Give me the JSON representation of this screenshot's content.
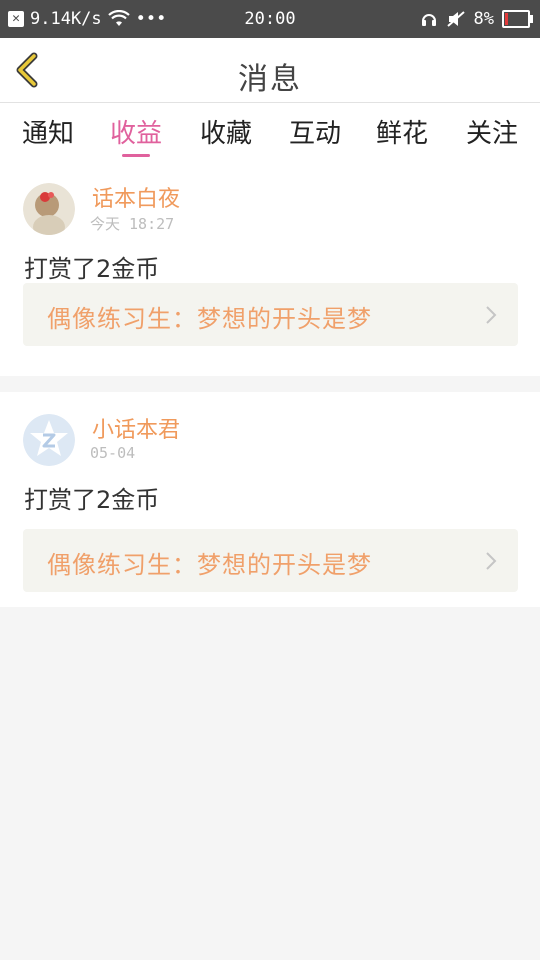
{
  "status_bar": {
    "net_speed": "9.14K/s",
    "dots": "•••",
    "time": "20:00",
    "battery": "8%"
  },
  "header": {
    "title": "消息"
  },
  "tabs": [
    {
      "label": "通知"
    },
    {
      "label": "收益"
    },
    {
      "label": "收藏"
    },
    {
      "label": "互动"
    },
    {
      "label": "鲜花"
    },
    {
      "label": "关注"
    }
  ],
  "active_tab": "收益",
  "messages": [
    {
      "user": "话本白夜",
      "time": "今天 18:27",
      "text": "打赏了2金币",
      "link": "偶像练习生：梦想的开头是梦"
    },
    {
      "user": "小话本君",
      "time": "05-04",
      "text": "打赏了2金币",
      "link": "偶像练习生：梦想的开头是梦"
    }
  ],
  "colors": {
    "accent": "#e0619d",
    "username": "#f09a5c",
    "link": "#f0a06a",
    "back_arrow": "#e8c93a"
  }
}
